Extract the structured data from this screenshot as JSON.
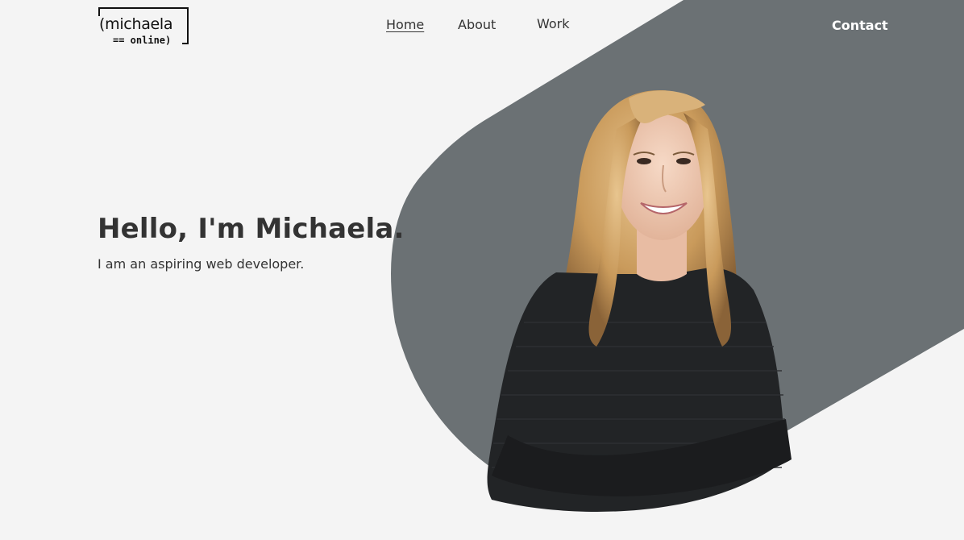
{
  "logo": {
    "main": "(michaela",
    "sub": "== online)"
  },
  "nav": {
    "home": "Home",
    "about": "About",
    "work": "Work",
    "contact": "Contact"
  },
  "hero": {
    "title": "Hello, I'm Michaela.",
    "subtitle": "I am an aspiring web developer."
  },
  "colors": {
    "background": "#f4f4f4",
    "shape": "#6b7174",
    "text": "#333333",
    "contact": "#ffffff"
  }
}
